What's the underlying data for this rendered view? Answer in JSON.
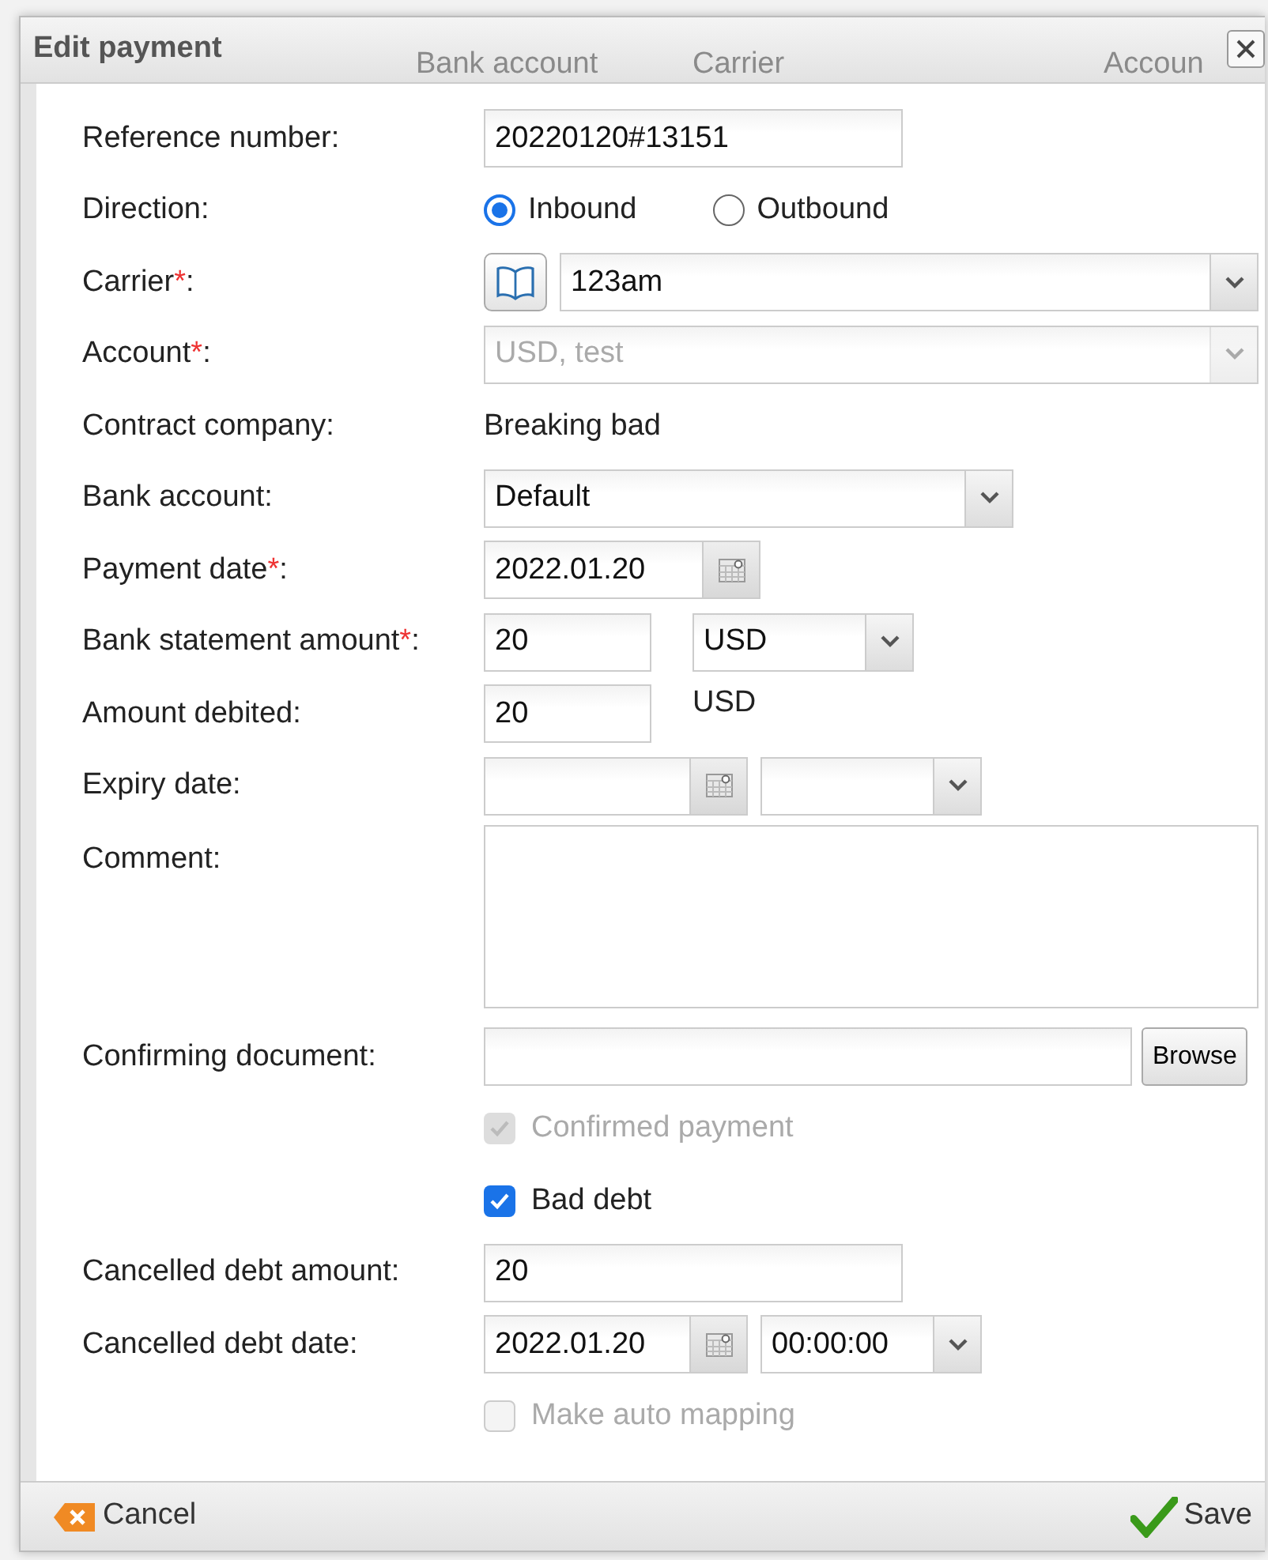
{
  "background_headers": [
    "Bank account",
    "Carrier",
    "Accoun"
  ],
  "dialog": {
    "title": "Edit payment"
  },
  "fields": [
    {
      "kind": "text",
      "label": "Reference number:",
      "value": "20220120#13151"
    },
    {
      "kind": "radio",
      "label": "Direction:",
      "options": [
        {
          "label": "Inbound",
          "selected": true
        },
        {
          "label": "Outbound",
          "selected": false
        }
      ]
    },
    {
      "kind": "lookup-select",
      "label": "Carrier",
      "required_mark": "*",
      "label_end": ":",
      "value": "123am"
    },
    {
      "kind": "select-wide",
      "label": "Account",
      "required_mark": "*",
      "label_end": ":",
      "value": "USD, test",
      "disabled": true
    },
    {
      "kind": "static",
      "label": "Contract company:",
      "value": "Breaking bad"
    },
    {
      "kind": "select",
      "label": "Bank account:",
      "value": "Default"
    },
    {
      "kind": "date",
      "label": "Payment date",
      "required_mark": "*",
      "label_end": ":",
      "value": "2022.01.20"
    },
    {
      "kind": "amount-select",
      "label": "Bank statement amount",
      "required_mark": "*",
      "label_end": ":",
      "value": "20",
      "currency": "USD"
    },
    {
      "kind": "amount-static",
      "label": "Amount debited:",
      "value": "20",
      "currency": "USD"
    },
    {
      "kind": "date-select",
      "label": "Expiry date:"
    },
    {
      "kind": "textarea",
      "label": "Comment:"
    },
    {
      "kind": "file",
      "label": "Confirming document:",
      "button": "Browse"
    },
    {
      "kind": "checkbox",
      "text": "Confirmed payment",
      "checked": true,
      "disabled": true
    },
    {
      "kind": "checkbox",
      "text": "Bad debt",
      "checked": true,
      "disabled": false
    },
    {
      "kind": "text",
      "label": "Cancelled debt amount:",
      "value": "20"
    },
    {
      "kind": "date-select",
      "label": "Cancelled debt date:",
      "value": "2022.01.20",
      "time": "00:00:00"
    },
    {
      "kind": "checkbox",
      "text": "Make auto mapping",
      "checked": false,
      "disabled": true
    }
  ],
  "footer": {
    "cancel": "Cancel",
    "save": "Save"
  }
}
